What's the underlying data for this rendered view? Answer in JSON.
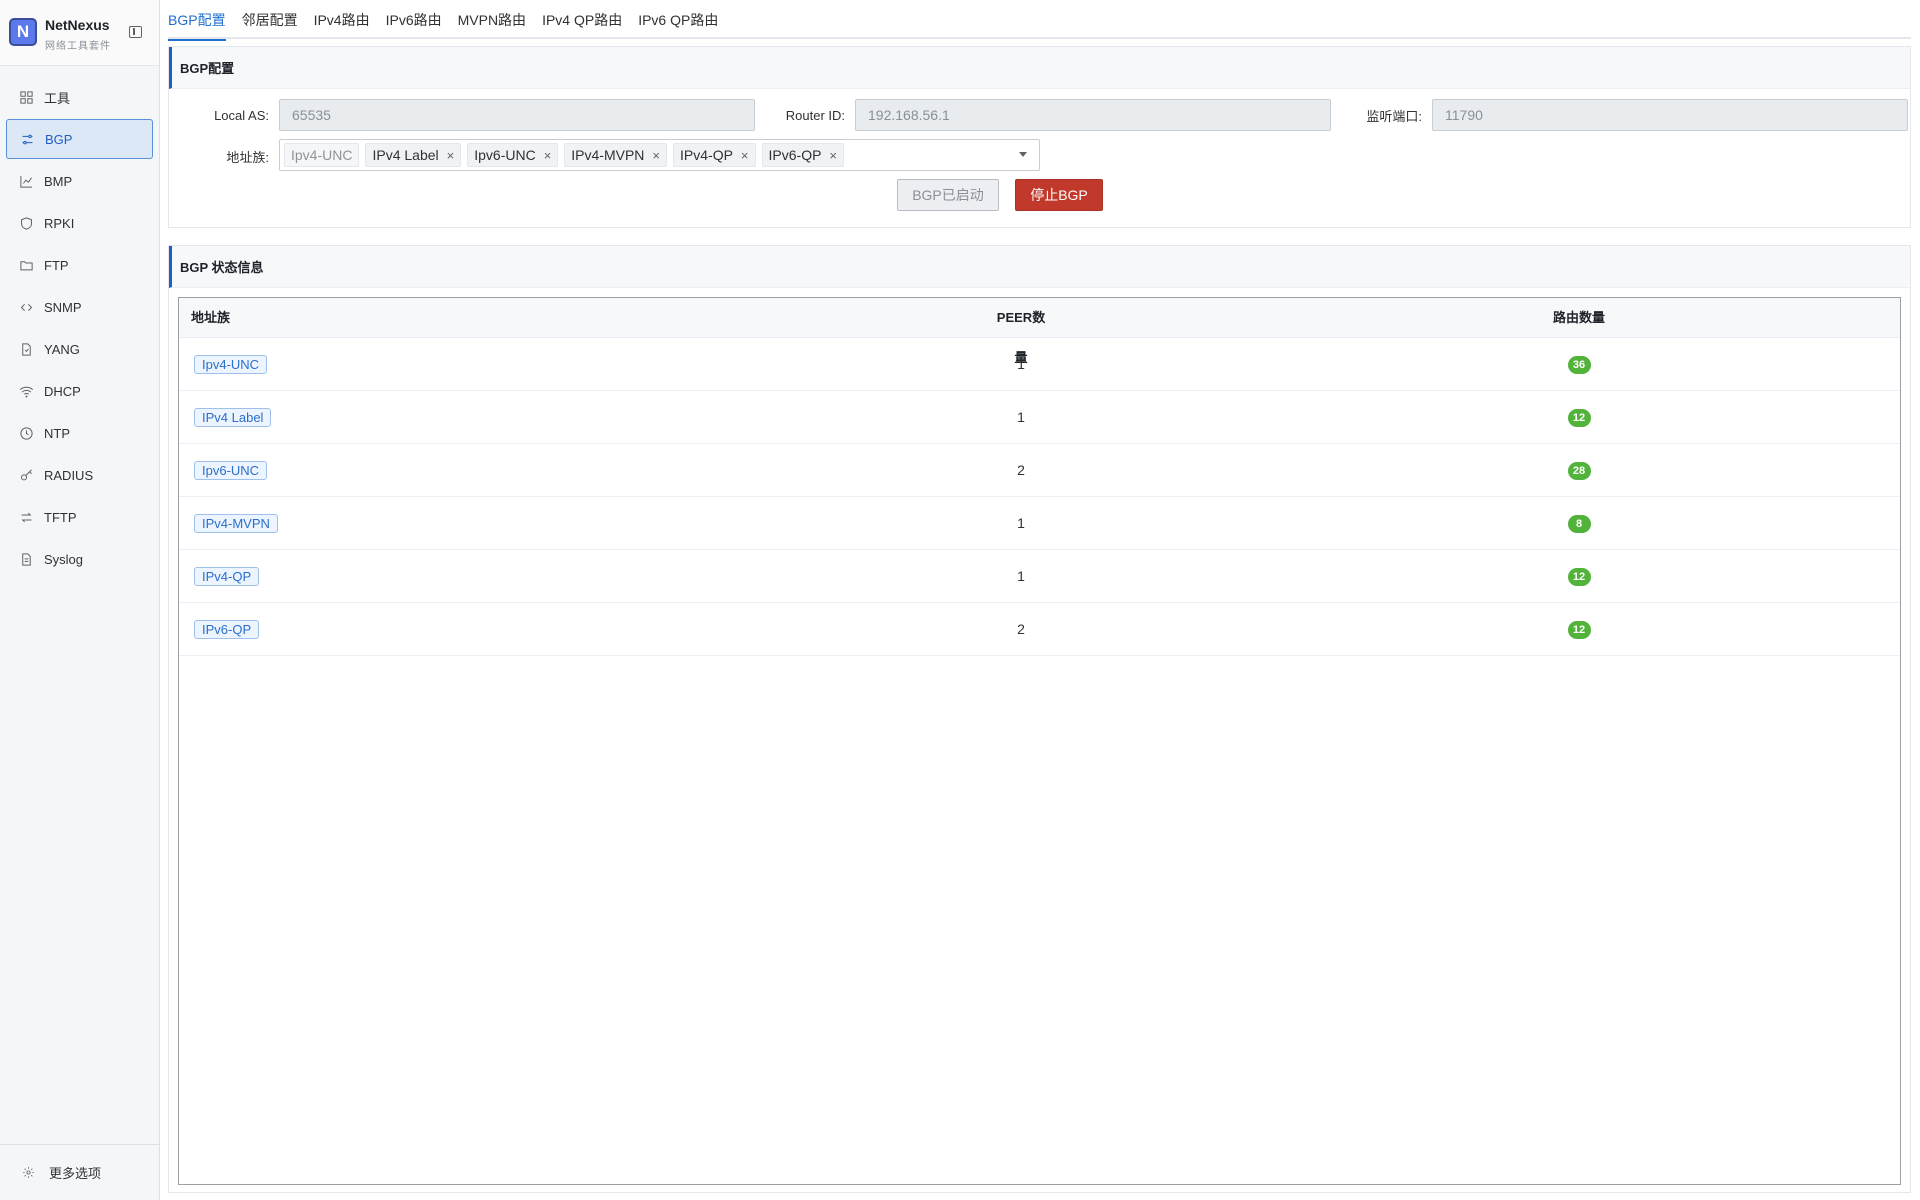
{
  "brand": {
    "logo_letter": "N",
    "name": "NetNexus",
    "subtitle": "网络工具套件"
  },
  "sidebar": {
    "items": [
      {
        "label": "工具",
        "icon": "grid-icon"
      },
      {
        "label": "BGP",
        "icon": "sliders-icon",
        "active": true
      },
      {
        "label": "BMP",
        "icon": "chart-icon"
      },
      {
        "label": "RPKI",
        "icon": "shield-icon"
      },
      {
        "label": "FTP",
        "icon": "folder-icon"
      },
      {
        "label": "SNMP",
        "icon": "code-icon"
      },
      {
        "label": "YANG",
        "icon": "file-icon"
      },
      {
        "label": "DHCP",
        "icon": "wifi-icon"
      },
      {
        "label": "NTP",
        "icon": "clock-icon"
      },
      {
        "label": "RADIUS",
        "icon": "key-icon"
      },
      {
        "label": "TFTP",
        "icon": "swap-icon"
      },
      {
        "label": "Syslog",
        "icon": "doc-icon"
      }
    ],
    "footer_label": "更多选项"
  },
  "tabs": [
    "BGP配置",
    "邻居配置",
    "IPv4路由",
    "IPv6路由",
    "MVPN路由",
    "IPv4 QP路由",
    "IPv6 QP路由"
  ],
  "active_tab": "BGP配置",
  "config": {
    "title": "BGP配置",
    "local_as_label": "Local AS:",
    "local_as_value": "65535",
    "router_id_label": "Router ID:",
    "router_id_value": "192.168.56.1",
    "port_label": "监听端口:",
    "port_value": "11790",
    "family_label": "地址族:",
    "families": [
      {
        "label": "Ipv4-UNC",
        "closable": false
      },
      {
        "label": "IPv4 Label",
        "closable": true
      },
      {
        "label": "Ipv6-UNC",
        "closable": true
      },
      {
        "label": "IPv4-MVPN",
        "closable": true
      },
      {
        "label": "IPv4-QP",
        "closable": true
      },
      {
        "label": "IPv6-QP",
        "closable": true
      }
    ],
    "started_button": "BGP已启动",
    "stop_button": "停止BGP"
  },
  "status": {
    "title": "BGP 状态信息",
    "columns": [
      "地址族",
      "PEER数量",
      "路由数量"
    ],
    "rows": [
      {
        "family": "Ipv4-UNC",
        "peers": "1",
        "routes": "36"
      },
      {
        "family": "IPv4 Label",
        "peers": "1",
        "routes": "12"
      },
      {
        "family": "Ipv6-UNC",
        "peers": "2",
        "routes": "28"
      },
      {
        "family": "IPv4-MVPN",
        "peers": "1",
        "routes": "8"
      },
      {
        "family": "IPv4-QP",
        "peers": "1",
        "routes": "12"
      },
      {
        "family": "IPv6-QP",
        "peers": "2",
        "routes": "12"
      }
    ]
  },
  "colors": {
    "accent": "#1f6fd1",
    "danger": "#c0392b",
    "success_badge": "#52b33a"
  }
}
